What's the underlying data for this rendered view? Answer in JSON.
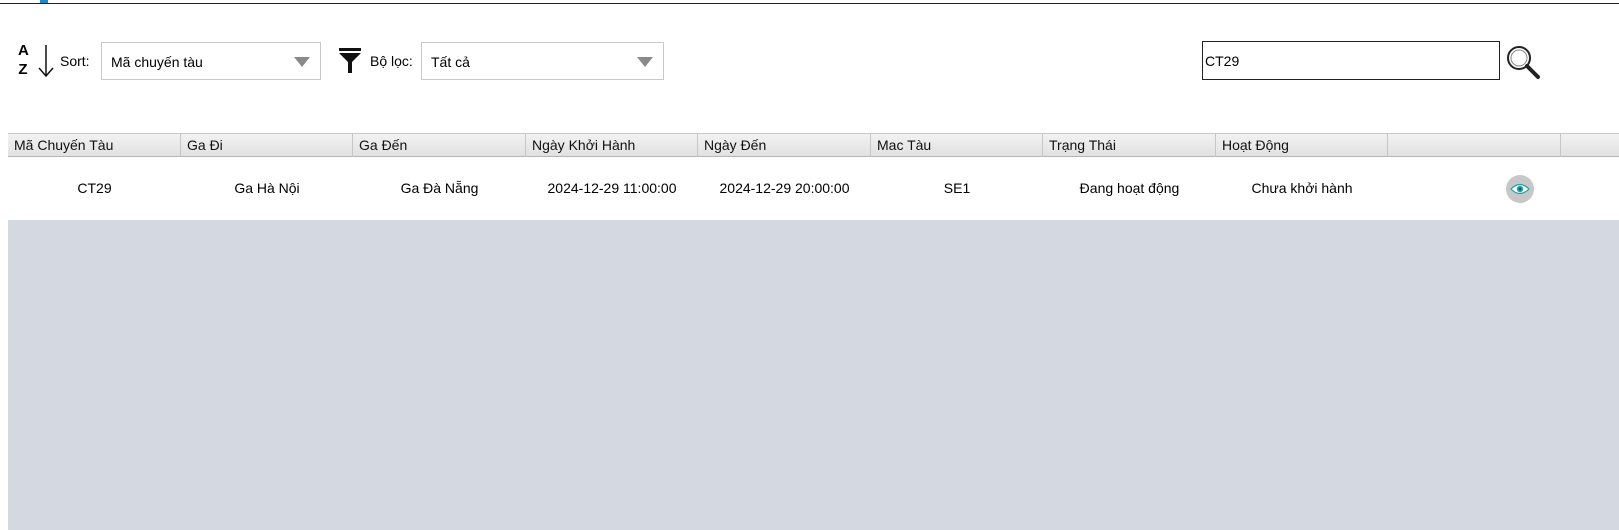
{
  "toolbar": {
    "sort_icon_top": "A",
    "sort_icon_bottom": "Z",
    "sort_label": "Sort:",
    "sort_value": "Mã chuyến tàu",
    "filter_label": "Bộ lọc:",
    "filter_value": "Tất cả",
    "search_value": "CT29"
  },
  "icons": {
    "sort": "sort-az-descending-icon",
    "filter": "funnel-filter-icon",
    "search": "magnifier-search-icon",
    "view": "eye-icon"
  },
  "colors": {
    "accent": "#1e88c8",
    "table_background": "#d4d8e1",
    "eye_icon": "#1aa3a8"
  },
  "table": {
    "columns": [
      "Mã Chuyến Tàu",
      "Ga Đi",
      "Ga Đến",
      "Ngày Khởi Hành",
      "Ngày Đến",
      "Mac Tàu",
      "Trạng Thái",
      "Hoạt Động"
    ],
    "rows": [
      {
        "ma_chuyen_tau": "CT29",
        "ga_di": "Ga Hà Nội",
        "ga_den": "Ga Đà Nẵng",
        "ngay_khoi_hanh": "2024-12-29 11:00:00",
        "ngay_den": "2024-12-29 20:00:00",
        "mac_tau": "SE1",
        "trang_thai": "Đang hoạt động",
        "hoat_dong": "Chưa khởi hành"
      }
    ]
  }
}
